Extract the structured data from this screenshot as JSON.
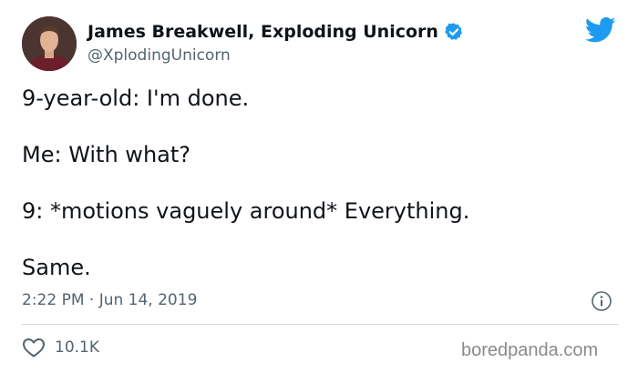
{
  "author": {
    "name": "James Breakwell, Exploding Unicorn",
    "handle": "@XplodingUnicorn",
    "verified": true,
    "avatar_icon": "user-avatar"
  },
  "platform": {
    "logo_icon": "twitter-bird-icon",
    "accent_color": "#1d9bf0"
  },
  "tweet": {
    "lines": [
      "9-year-old: I'm done.",
      "Me: With what?",
      "9: *motions vaguely around* Everything.",
      "Same."
    ],
    "timestamp": "2:22 PM · Jun 14, 2019"
  },
  "metrics": {
    "likes": "10.1K"
  },
  "watermark": "boredpanda.com",
  "colors": {
    "text": "#0f1419",
    "secondary": "#536471",
    "divider": "#cfd9de"
  }
}
